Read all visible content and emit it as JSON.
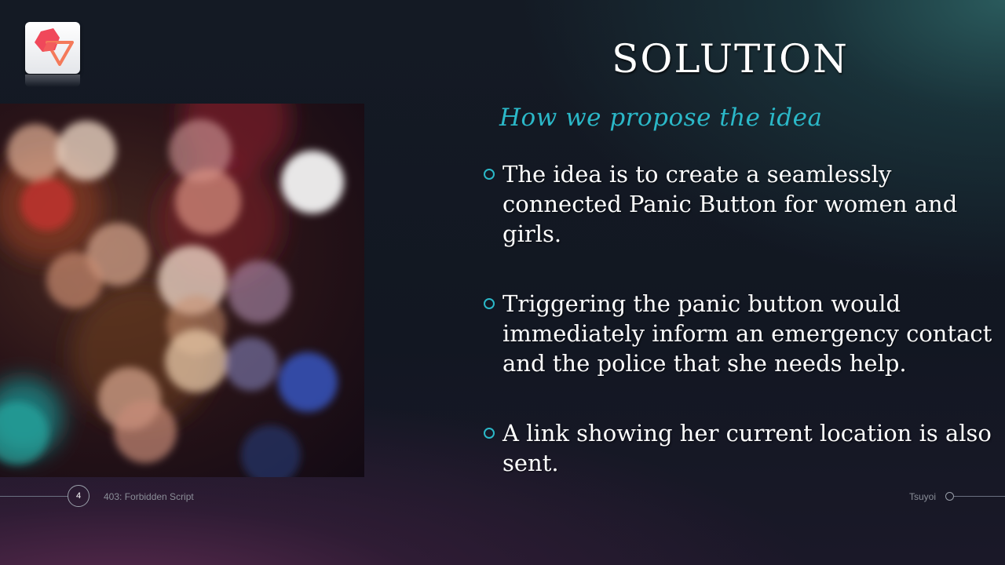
{
  "slide": {
    "title": "SOLUTION",
    "subtitle": "How we propose the idea",
    "bullets": [
      "The idea is to create a seamlessly connected Panic Button for women and girls.",
      "Triggering the panic button would immediately inform an emergency contact and the police that she needs help.",
      "A link showing her current location is also sent."
    ]
  },
  "footer": {
    "page_number": "4",
    "left_text": "403: Forbidden  Script",
    "right_text": "Tsuyoi"
  },
  "colors": {
    "accent": "#2bb8c8",
    "title": "#ffffff",
    "logo_primary": "#f0485a",
    "logo_secondary": "#f47a5a"
  },
  "icons": {
    "logo": "hexagon-triangle-logo",
    "bullet": "hollow-circle-bullet"
  }
}
